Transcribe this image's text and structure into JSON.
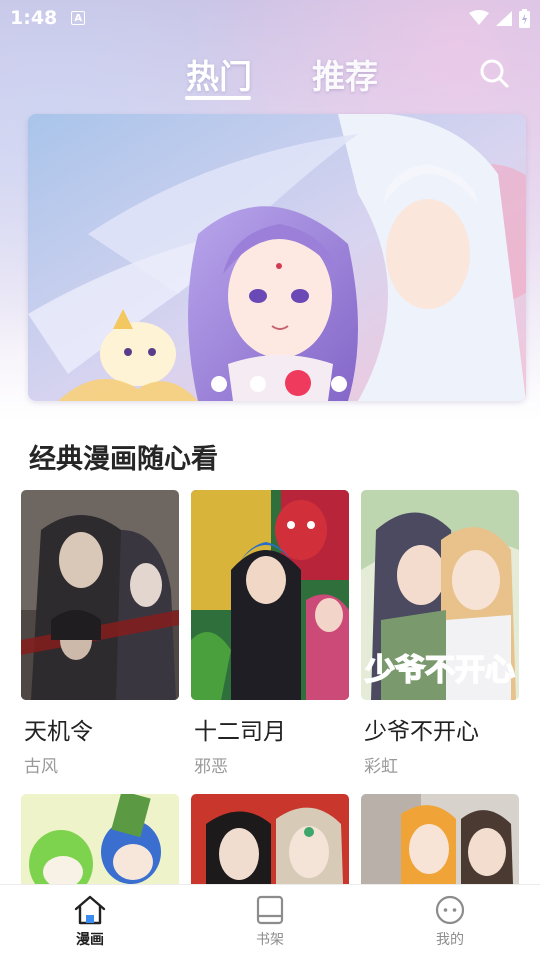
{
  "status_bar": {
    "time": "1:48",
    "notification_letter": "A"
  },
  "tabs": [
    {
      "label": "热门",
      "active": true
    },
    {
      "label": "推荐",
      "active": false
    }
  ],
  "banner": {
    "page_count": 4,
    "active_index": 2,
    "accent_color": "#ef3a5d"
  },
  "section": {
    "title": "经典漫画随心看",
    "comics": [
      {
        "title": "天机令",
        "genre": "古风"
      },
      {
        "title": "十二司月",
        "genre": "邪恶"
      },
      {
        "title": "少爷不开心",
        "genre": "彩虹"
      }
    ]
  },
  "bottom_nav": {
    "items": [
      {
        "label": "漫画",
        "icon": "home-icon",
        "active": true
      },
      {
        "label": "书架",
        "icon": "bookshelf-icon",
        "active": false
      },
      {
        "label": "我的",
        "icon": "face-icon",
        "active": false
      }
    ]
  }
}
